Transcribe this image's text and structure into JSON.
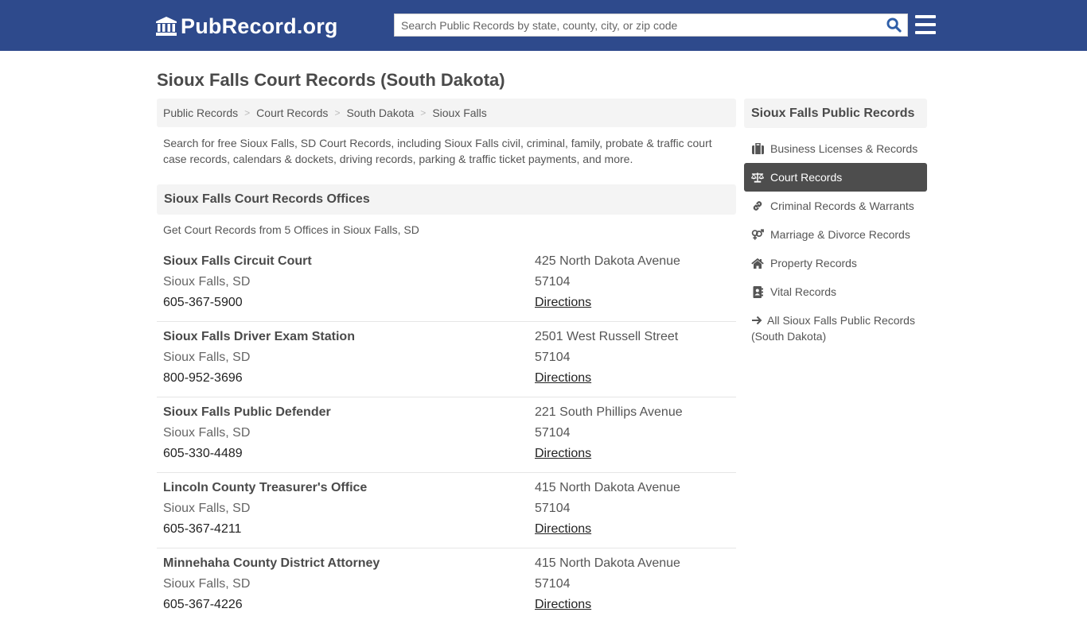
{
  "header": {
    "logo_text": "PubRecord.org",
    "search_placeholder": "Search Public Records by state, county, city, or zip code",
    "search_value": "",
    "colors": {
      "bar": "#2e4a8c",
      "search_icon": "#2e5ea8"
    }
  },
  "page": {
    "title": "Sioux Falls Court Records (South Dakota)",
    "breadcrumb": [
      {
        "label": "Public Records"
      },
      {
        "label": "Court Records"
      },
      {
        "label": "South Dakota"
      },
      {
        "label": "Sioux Falls"
      }
    ],
    "breadcrumb_separator": ">",
    "intro": "Search for free Sioux Falls, SD Court Records, including Sioux Falls civil, criminal, family, probate & traffic court case records, calendars & dockets, driving records, parking & traffic ticket payments, and more.",
    "section_title": "Sioux Falls Court Records Offices",
    "section_subtitle": "Get Court Records from 5 Offices in Sioux Falls, SD"
  },
  "offices": [
    {
      "name": "Sioux Falls Circuit Court",
      "city": "Sioux Falls, SD",
      "phone": "605-367-5900",
      "address": "425 North Dakota Avenue",
      "zip": "57104",
      "directions": "Directions"
    },
    {
      "name": "Sioux Falls Driver Exam Station",
      "city": "Sioux Falls, SD",
      "phone": "800-952-3696",
      "address": "2501 West Russell Street",
      "zip": "57104",
      "directions": "Directions"
    },
    {
      "name": "Sioux Falls Public Defender",
      "city": "Sioux Falls, SD",
      "phone": "605-330-4489",
      "address": "221 South Phillips Avenue",
      "zip": "57104",
      "directions": "Directions"
    },
    {
      "name": "Lincoln County Treasurer's Office",
      "city": "Sioux Falls, SD",
      "phone": "605-367-4211",
      "address": "415 North Dakota Avenue",
      "zip": "57104",
      "directions": "Directions"
    },
    {
      "name": "Minnehaha County District Attorney",
      "city": "Sioux Falls, SD",
      "phone": "605-367-4226",
      "address": "415 North Dakota Avenue",
      "zip": "57104",
      "directions": "Directions"
    }
  ],
  "sidebar": {
    "title": "Sioux Falls Public Records",
    "items": [
      {
        "label": "Business Licenses & Records",
        "icon": "briefcase-icon",
        "active": false
      },
      {
        "label": "Court Records",
        "icon": "balance-scale-icon",
        "active": true
      },
      {
        "label": "Criminal Records & Warrants",
        "icon": "link-icon",
        "active": false
      },
      {
        "label": "Marriage & Divorce Records",
        "icon": "venus-mars-icon",
        "active": false
      },
      {
        "label": "Property Records",
        "icon": "home-icon",
        "active": false
      },
      {
        "label": "Vital Records",
        "icon": "address-book-icon",
        "active": false
      }
    ],
    "all_link": "All Sioux Falls Public Records (South Dakota)",
    "all_link_icon": "arrow-right-icon"
  }
}
